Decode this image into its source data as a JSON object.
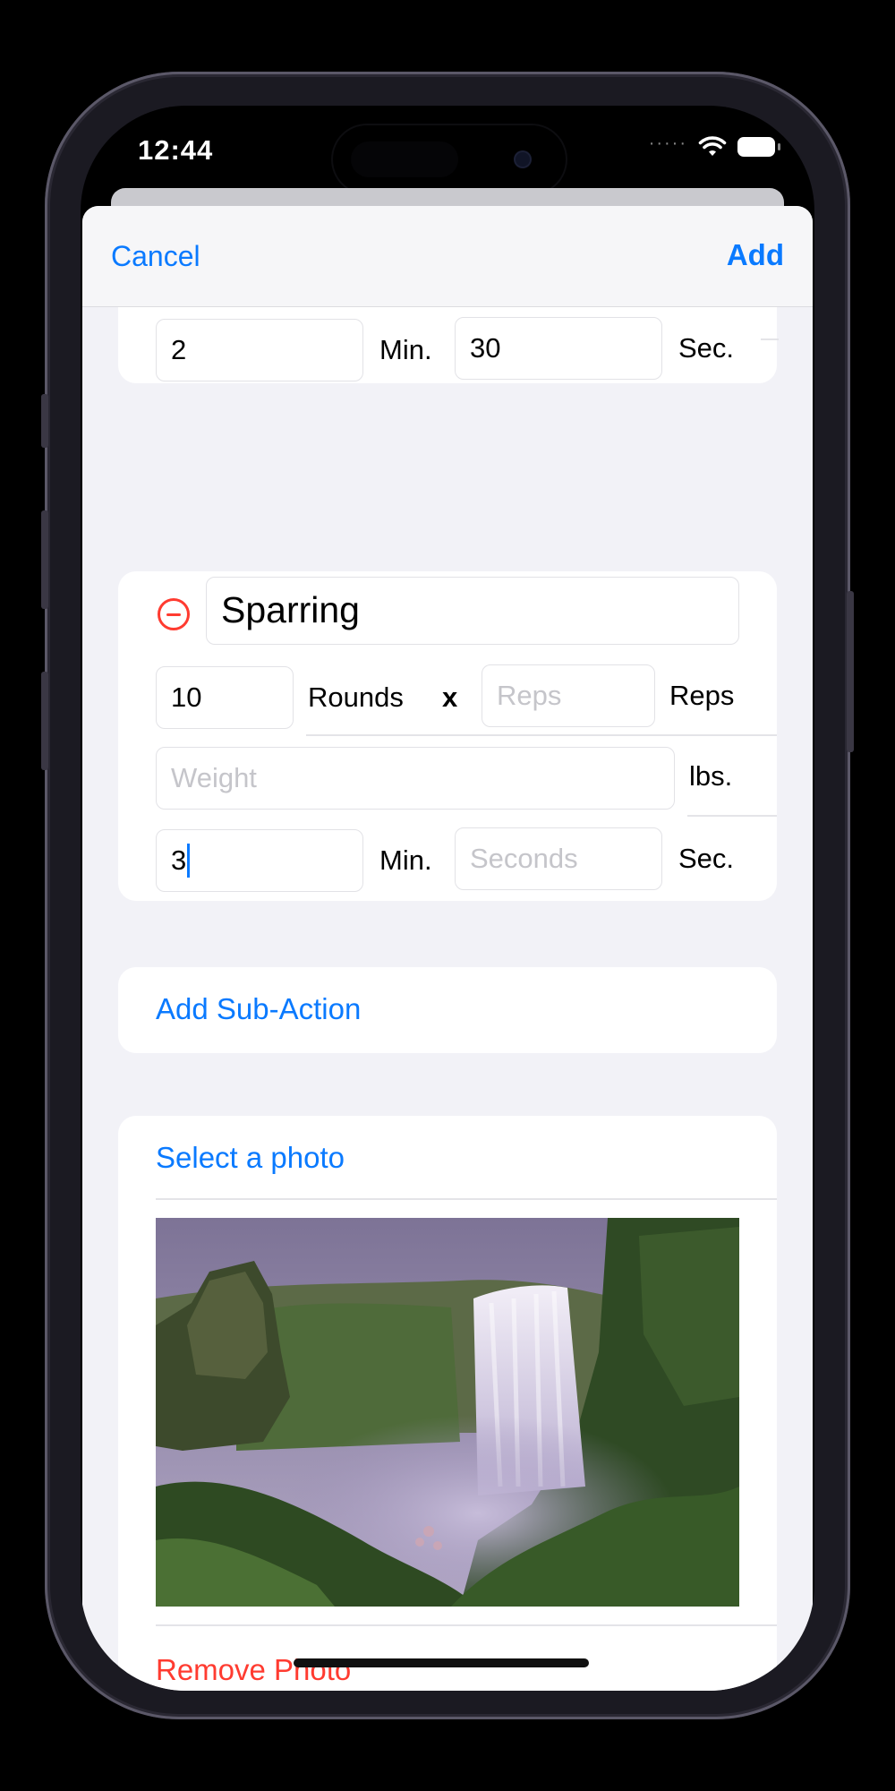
{
  "status": {
    "time": "12:44"
  },
  "nav": {
    "cancel": "Cancel",
    "add": "Add"
  },
  "prev_action": {
    "minutes": "2",
    "min_label": "Min.",
    "seconds": "30",
    "sec_label": "Sec."
  },
  "action": {
    "name": "Sparring",
    "rounds": "10",
    "rounds_label": "Rounds",
    "times": "x",
    "reps_placeholder": "Reps",
    "reps_label": "Reps",
    "weight_placeholder": "Weight",
    "weight_label": "lbs.",
    "minutes": "3",
    "min_label": "Min.",
    "seconds_placeholder": "Seconds",
    "sec_label": "Sec."
  },
  "add_sub_action": "Add Sub-Action",
  "photo_section": {
    "select": "Select a photo",
    "remove": "Remove Photo"
  },
  "colors": {
    "accent": "#0a7aff",
    "destructive": "#ff3b30",
    "background": "#f2f2f7"
  }
}
